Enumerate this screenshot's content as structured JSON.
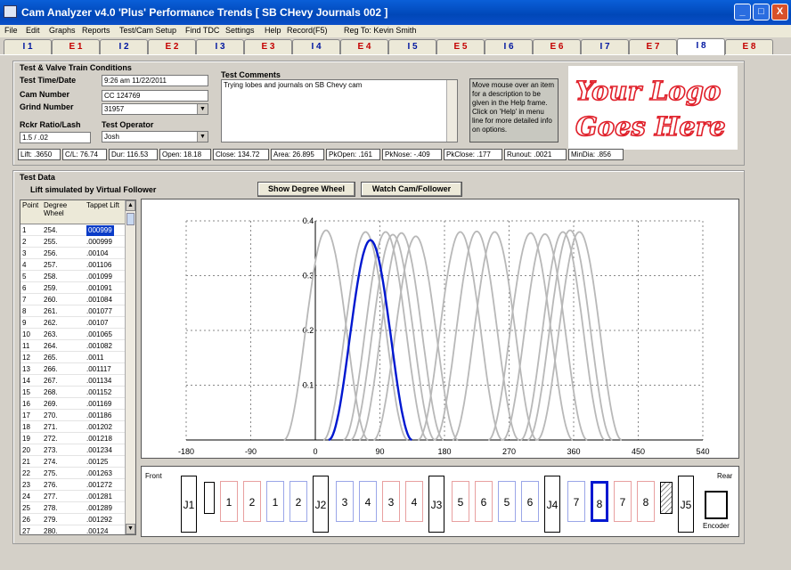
{
  "window": {
    "title": "Cam Analyzer v4.0 'Plus'  Performance Trends   [ SB CHevy Journals 002 ]",
    "minimize": "_",
    "maximize": "□",
    "close": "X"
  },
  "menu": [
    {
      "label": "File"
    },
    {
      "label": "Edit"
    },
    {
      "label": "Graphs"
    },
    {
      "label": "Reports"
    },
    {
      "label": "Test/Cam Setup"
    },
    {
      "label": "Find TDC"
    },
    {
      "label": "Settings"
    },
    {
      "label": "Help"
    },
    {
      "label": "Record(F5)"
    },
    {
      "label": "Reg To: Kevin Smith"
    }
  ],
  "tabs": [
    {
      "label": "I 1",
      "kind": "intake"
    },
    {
      "label": "E 1",
      "kind": "exhaust"
    },
    {
      "label": "I 2",
      "kind": "intake"
    },
    {
      "label": "E 2",
      "kind": "exhaust"
    },
    {
      "label": "I 3",
      "kind": "intake"
    },
    {
      "label": "E 3",
      "kind": "exhaust"
    },
    {
      "label": "I 4",
      "kind": "intake"
    },
    {
      "label": "E 4",
      "kind": "exhaust"
    },
    {
      "label": "I 5",
      "kind": "intake"
    },
    {
      "label": "E 5",
      "kind": "exhaust"
    },
    {
      "label": "I 6",
      "kind": "intake"
    },
    {
      "label": "E 6",
      "kind": "exhaust"
    },
    {
      "label": "I 7",
      "kind": "intake"
    },
    {
      "label": "E 7",
      "kind": "exhaust"
    },
    {
      "label": "I 8",
      "kind": "intake",
      "active": true
    },
    {
      "label": "E 8",
      "kind": "exhaust"
    }
  ],
  "conditions": {
    "heading": "Test & Valve Train Conditions",
    "time_label": "Test Time/Date",
    "time_value": "9:26 am  11/22/2011",
    "cam_label": "Cam Number",
    "cam_value": "CC 124769",
    "grind_label": "Grind Number",
    "grind_value": "31957",
    "rocker_label": "Rckr Ratio/Lash",
    "rocker_value": "1.5 / .02",
    "operator_label": "Test Operator",
    "operator_value": "Josh"
  },
  "comments": {
    "label": "Test Comments",
    "text": "Trying lobes and journals on SB Chevy cam"
  },
  "help_text": "Move mouse over an item for a description to be given in the Help frame.  Click on 'Help' in menu line for more detailed info on options.",
  "logo": {
    "line1": "Your Logo",
    "line2": "Goes Here",
    "color": "#e0202a"
  },
  "stats": [
    "Lift: .3650",
    "C/L: 76.74",
    "Dur: 116.53",
    "Open: 18.18",
    "Close: 134.72",
    "Area: 26.895",
    "PkOpen: .161",
    "PkNose: -.409",
    "PkClose: .177",
    "Runout: .0021",
    "MinDia: .856"
  ],
  "test_data": {
    "heading": "Test Data",
    "subheading": "Lift simulated by Virtual Follower",
    "show_wheel": "Show Degree Wheel",
    "watch_cam": "Watch Cam/Follower"
  },
  "table": {
    "col_point": "Point",
    "col_degree": "Degree Wheel",
    "col_lift": "Tappet Lift",
    "rows": [
      [
        "1",
        "254.",
        "000999"
      ],
      [
        "2",
        "255.",
        ".000999"
      ],
      [
        "3",
        "256.",
        ".00104"
      ],
      [
        "4",
        "257.",
        ".001106"
      ],
      [
        "5",
        "258.",
        ".001099"
      ],
      [
        "6",
        "259.",
        ".001091"
      ],
      [
        "7",
        "260.",
        ".001084"
      ],
      [
        "8",
        "261.",
        ".001077"
      ],
      [
        "9",
        "262.",
        ".00107"
      ],
      [
        "10",
        "263.",
        ".001065"
      ],
      [
        "11",
        "264.",
        ".001082"
      ],
      [
        "12",
        "265.",
        ".0011"
      ],
      [
        "13",
        "266.",
        ".001117"
      ],
      [
        "14",
        "267.",
        ".001134"
      ],
      [
        "15",
        "268.",
        ".001152"
      ],
      [
        "16",
        "269.",
        ".001169"
      ],
      [
        "17",
        "270.",
        ".001186"
      ],
      [
        "18",
        "271.",
        ".001202"
      ],
      [
        "19",
        "272.",
        ".001218"
      ],
      [
        "20",
        "273.",
        ".001234"
      ],
      [
        "21",
        "274.",
        ".00125"
      ],
      [
        "22",
        "275.",
        ".001263"
      ],
      [
        "23",
        "276.",
        ".001272"
      ],
      [
        "24",
        "277.",
        ".001281"
      ],
      [
        "25",
        "278.",
        ".001289"
      ],
      [
        "26",
        "279.",
        ".001292"
      ],
      [
        "27",
        "280.",
        ".00124"
      ]
    ]
  },
  "chart_data": {
    "type": "line",
    "x_ticks": [
      "-180",
      "-90",
      "0",
      "90",
      "180",
      "270",
      "360",
      "450",
      "540"
    ],
    "y_ticks": [
      "0.1",
      "0.2",
      "0.3",
      "0.4"
    ],
    "xlim": [
      -180,
      540
    ],
    "ylim": [
      0,
      0.4
    ],
    "grid": true,
    "highlight": {
      "name": "I 8",
      "color": "#0018d0",
      "centerline": 76.74,
      "peak": 0.365,
      "duration": 116.53
    },
    "series": [
      {
        "centerline": 15,
        "peak": 0.383,
        "color": "#b8b8b8"
      },
      {
        "centerline": 70,
        "peak": 0.38,
        "color": "#b8b8b8"
      },
      {
        "centerline": 98,
        "peak": 0.38,
        "color": "#b8b8b8"
      },
      {
        "centerline": 108,
        "peak": 0.375,
        "color": "#b8b8b8"
      },
      {
        "centerline": 120,
        "peak": 0.378,
        "color": "#b8b8b8"
      },
      {
        "centerline": 140,
        "peak": 0.372,
        "color": "#b8b8b8"
      },
      {
        "centerline": 202,
        "peak": 0.38,
        "color": "#b8b8b8"
      },
      {
        "centerline": 225,
        "peak": 0.381,
        "color": "#b8b8b8"
      },
      {
        "centerline": 250,
        "peak": 0.38,
        "color": "#b8b8b8"
      },
      {
        "centerline": 300,
        "peak": 0.378,
        "color": "#b8b8b8"
      },
      {
        "centerline": 320,
        "peak": 0.376,
        "color": "#b8b8b8"
      },
      {
        "centerline": 345,
        "peak": 0.38,
        "color": "#b8b8b8"
      },
      {
        "centerline": 355,
        "peak": 0.383,
        "color": "#b8b8b8"
      },
      {
        "centerline": 368,
        "peak": 0.38,
        "color": "#b8b8b8"
      }
    ]
  },
  "journals": {
    "front": "Front",
    "rear": "Rear",
    "encoder": "Encoder",
    "items": [
      {
        "label": "J1",
        "type": "journal"
      },
      {
        "label": "",
        "type": "blank"
      },
      {
        "label": "1",
        "type": "exhaust"
      },
      {
        "label": "2",
        "type": "exhaust"
      },
      {
        "label": "1",
        "type": "intake"
      },
      {
        "label": "2",
        "type": "intake"
      },
      {
        "label": "J2",
        "type": "journal"
      },
      {
        "label": "3",
        "type": "intake"
      },
      {
        "label": "4",
        "type": "intake"
      },
      {
        "label": "3",
        "type": "exhaust"
      },
      {
        "label": "4",
        "type": "exhaust"
      },
      {
        "label": "J3",
        "type": "journal"
      },
      {
        "label": "5",
        "type": "exhaust"
      },
      {
        "label": "6",
        "type": "exhaust"
      },
      {
        "label": "5",
        "type": "intake"
      },
      {
        "label": "6",
        "type": "intake"
      },
      {
        "label": "J4",
        "type": "journal"
      },
      {
        "label": "7",
        "type": "intake"
      },
      {
        "label": "8",
        "type": "intake",
        "active": true
      },
      {
        "label": "7",
        "type": "exhaust"
      },
      {
        "label": "8",
        "type": "exhaust"
      },
      {
        "label": "",
        "type": "hatched"
      },
      {
        "label": "J5",
        "type": "journal"
      }
    ]
  }
}
